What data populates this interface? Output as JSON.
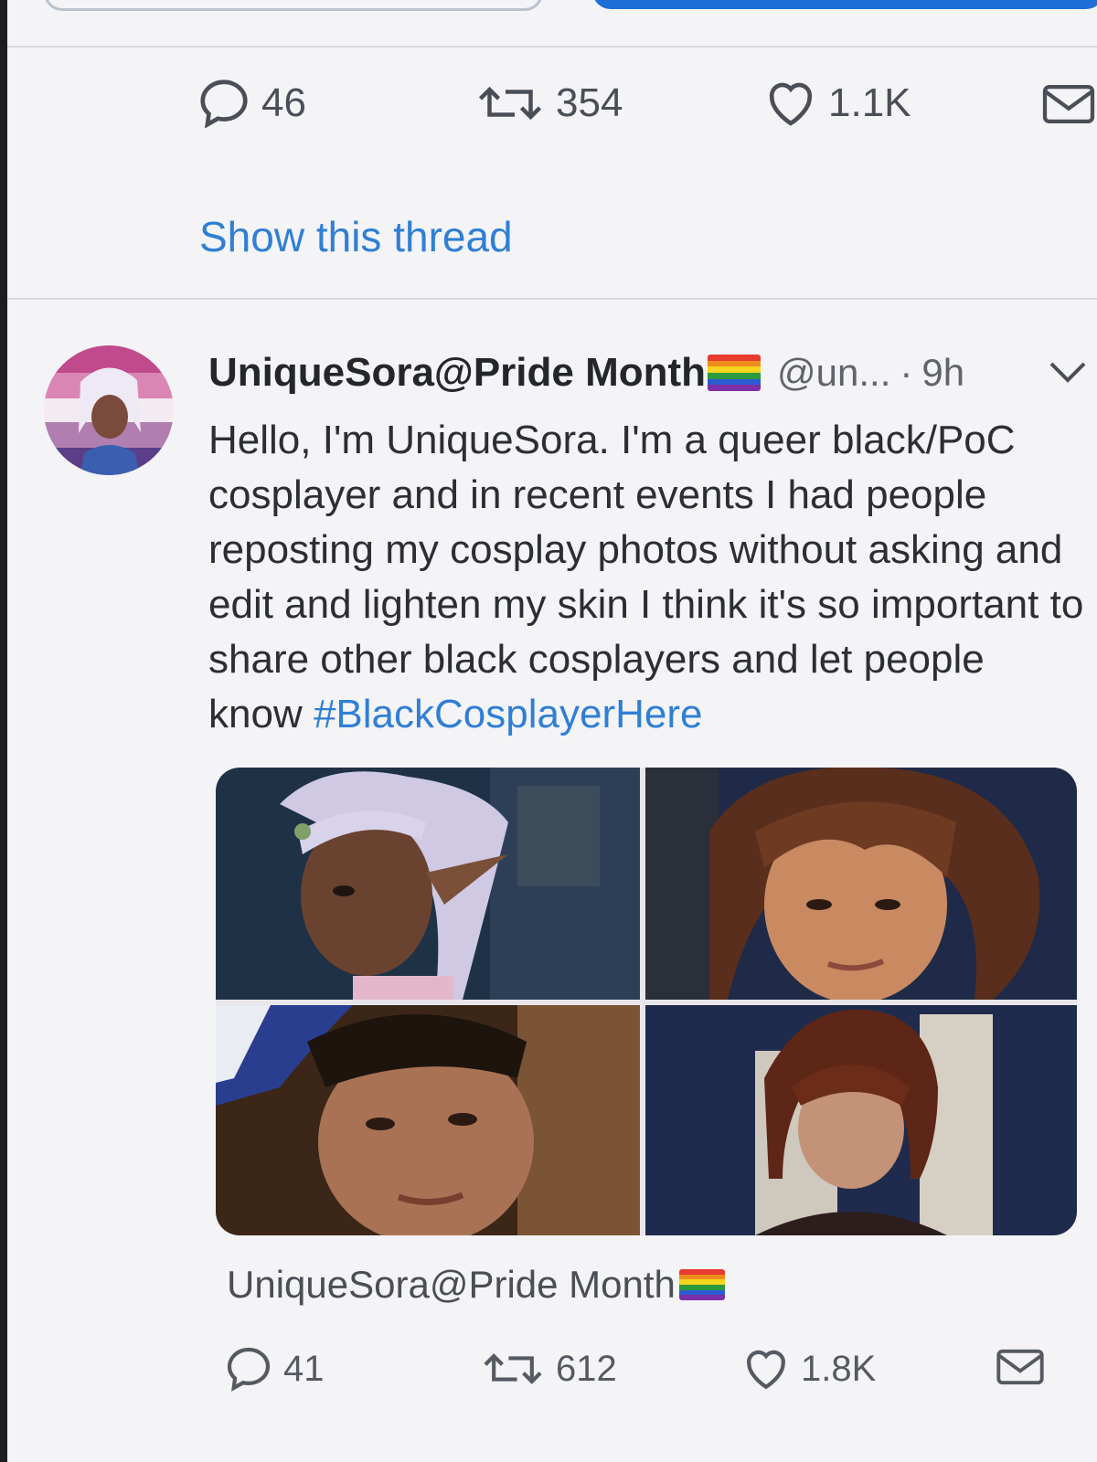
{
  "first_tweet": {
    "actions": {
      "replies": "46",
      "retweets": "354",
      "likes": "1.1K"
    },
    "show_thread": "Show this thread"
  },
  "tweet": {
    "display_name": "UniqueSora@Pride Month",
    "handle": "@un...",
    "separator": "·",
    "time": "9h",
    "text": "Hello, I'm UniqueSora. I'm a queer black/PoC cosplayer and in recent events I had people reposting my cosplay photos without asking and edit and lighten my skin I think it's so important to share other black cosplayers and let people know ",
    "hashtag": "#BlackCosplayerHere",
    "images": [
      {
        "name": "photo-1",
        "desc_icon": "image-icon"
      },
      {
        "name": "photo-2",
        "desc_icon": "image-icon"
      },
      {
        "name": "photo-3",
        "desc_icon": "image-icon"
      },
      {
        "name": "photo-4",
        "desc_icon": "image-icon"
      }
    ],
    "footer_name": "UniqueSora@Pride Month",
    "actions": {
      "replies": "41",
      "retweets": "612",
      "likes": "1.8K"
    }
  },
  "icons": {
    "reply": "reply-icon",
    "retweet": "retweet-icon",
    "like": "heart-icon",
    "share": "mail-icon",
    "more": "chevron-down-icon",
    "flag": "rainbow-flag-icon"
  },
  "colors": {
    "link": "#2f7fd4",
    "primary_button": "#1d6fd6",
    "background": "#f4f3f6"
  }
}
